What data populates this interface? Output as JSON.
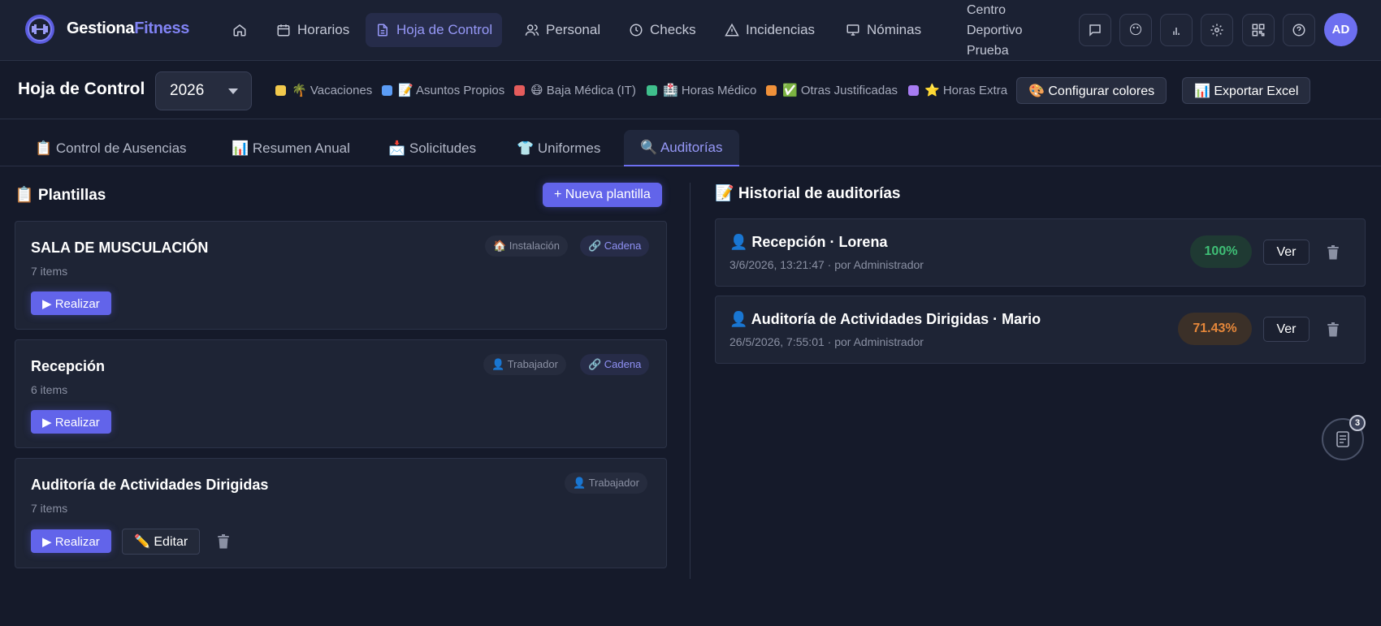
{
  "app": {
    "brand_main": "Gestiona",
    "brand_accent": "Fitness"
  },
  "nav": {
    "items": [
      {
        "label": ""
      },
      {
        "label": "Horarios"
      },
      {
        "label": "Hoja de Control"
      },
      {
        "label": "Personal"
      },
      {
        "label": "Checks"
      },
      {
        "label": "Incidencias"
      },
      {
        "label": "Nóminas"
      }
    ],
    "center_name": "Centro Deportivo Prueba",
    "avatar": "AD"
  },
  "subheader": {
    "title": "Hoja de Control",
    "year": "2026",
    "legend": [
      {
        "label": "🌴 Vacaciones",
        "color": "#f2c94c"
      },
      {
        "label": "📝 Asuntos Propios",
        "color": "#5b9cf5"
      },
      {
        "label": "😷 Baja Médica (IT)",
        "color": "#e45c5c"
      },
      {
        "label": "🏥 Horas Médico",
        "color": "#3fbf8c"
      },
      {
        "label": "✅ Otras Justificadas",
        "color": "#f0913a"
      },
      {
        "label": "⭐ Horas Extra",
        "color": "#a77cf2"
      }
    ],
    "configure_colors": "🎨 Configurar colores",
    "export_excel": "📊 Exportar Excel"
  },
  "tabs": [
    {
      "label": "📋 Control de Ausencias"
    },
    {
      "label": "📊 Resumen Anual"
    },
    {
      "label": "📩 Solicitudes"
    },
    {
      "label": "👕 Uniformes"
    },
    {
      "label": "🔍 Auditorías"
    }
  ],
  "templates": {
    "title": "📋 Plantillas",
    "new_button": "+ Nueva plantilla",
    "perform_label": "▶ Realizar",
    "edit_label": "✏️ Editar",
    "items": [
      {
        "name": "SALA DE MUSCULACIÓN",
        "count": "7 items",
        "type_badge": "🏠 Instalación",
        "chain_badge": "🔗 Cadena"
      },
      {
        "name": "Recepción",
        "count": "6 items",
        "type_badge": "👤 Trabajador",
        "chain_badge": "🔗 Cadena"
      },
      {
        "name": "Auditoría de Actividades Dirigidas",
        "count": "7 items",
        "type_badge": "👤 Trabajador"
      }
    ]
  },
  "history": {
    "title": "📝 Historial de auditorías",
    "view_label": "Ver",
    "items": [
      {
        "title": "👤 Recepción · Lorena",
        "meta": "3/6/2026, 13:21:47 · por Administrador",
        "score": "100%"
      },
      {
        "title": "👤 Auditoría de Actividades Dirigidas · Mario",
        "meta": "26/5/2026, 7:55:01 · por Administrador",
        "score": "71.43%"
      }
    ]
  },
  "floating": {
    "count": "3"
  }
}
